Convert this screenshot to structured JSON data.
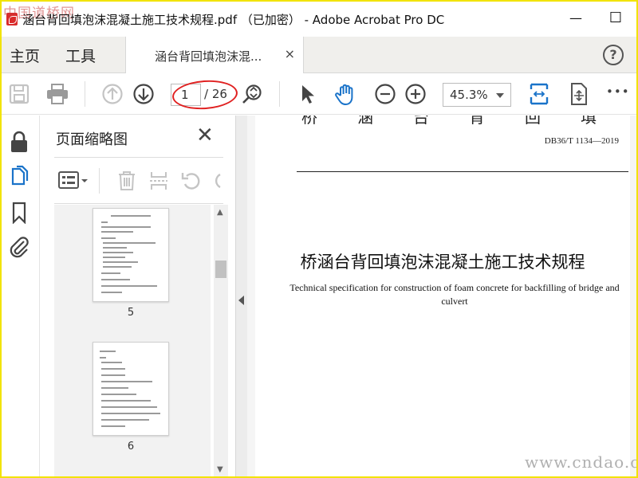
{
  "window": {
    "title": "涵台背回填泡沫混凝土施工技术规程.pdf （已加密） - Adobe Acrobat Pro DC",
    "minimize_glyph": "—",
    "maximize_glyph": "☐"
  },
  "watermarks": {
    "top": "中国道桥网",
    "bottom": "www.cndao.com"
  },
  "menu": {
    "home": "主页",
    "tools": "工具",
    "doc_tab_label": "涵台背回填泡沫混...",
    "doc_tab_close": "×",
    "help": "?"
  },
  "toolbar": {
    "current_page": "1",
    "total_pages": "/ 26",
    "zoom": "45.3%",
    "more": "•••",
    "icons": [
      "save-icon",
      "print-icon",
      "prev-page-icon",
      "next-page-icon",
      "zoom-tool-icon",
      "select-arrow-icon",
      "hand-icon",
      "zoom-out-icon",
      "zoom-in-icon",
      "fit-page-icon",
      "rotate-view-icon",
      "more-icon"
    ]
  },
  "highlight": {
    "color": "#e02020"
  },
  "rail": {
    "icons": [
      "lock-icon",
      "pages-icon",
      "bookmark-icon",
      "attachment-icon"
    ],
    "accent": "#1a73c9"
  },
  "thumb_panel": {
    "title": "页面缩略图",
    "close": "✕",
    "thumbnails": [
      {
        "page": "5"
      },
      {
        "page": "6"
      }
    ]
  },
  "document": {
    "top_partial_chars": "桥涵台背回填泡沫",
    "standard_code": "DB36/T 1134—2019",
    "title_cn": "桥涵台背回填泡沫混凝土施工技术规程",
    "title_en": "Technical specification for construction of foam concrete for backfilling of bridge and culvert"
  }
}
